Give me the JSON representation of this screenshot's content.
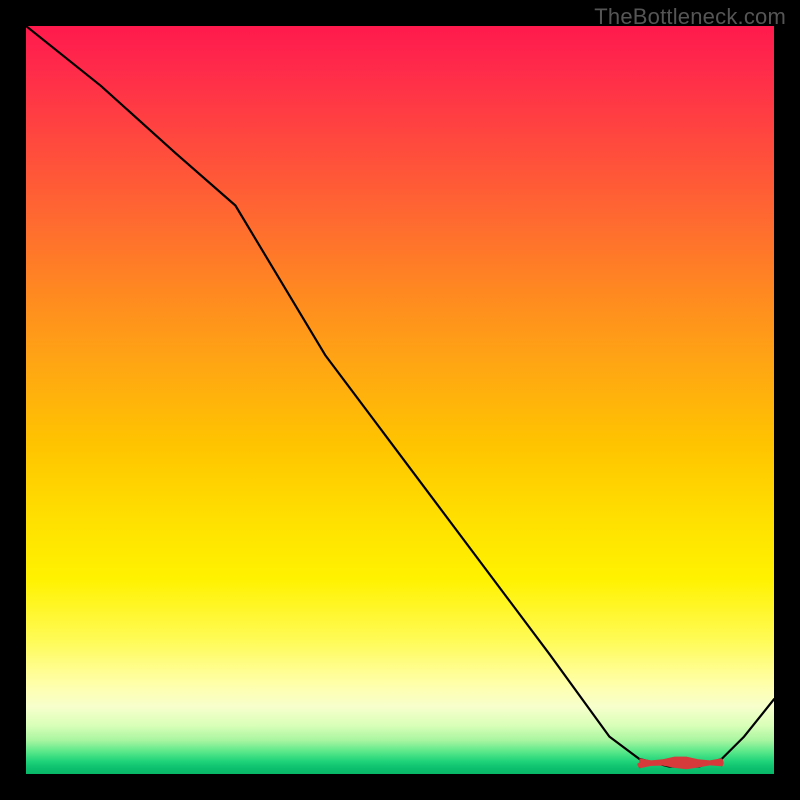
{
  "watermark": "TheBottleneck.com",
  "chart_data": {
    "type": "line",
    "title": "",
    "xlabel": "",
    "ylabel": "",
    "xlim": [
      0,
      100
    ],
    "ylim": [
      0,
      100
    ],
    "grid": false,
    "legend": false,
    "background": {
      "gradient": "vertical",
      "stops": [
        {
          "pos": 0.0,
          "color": "#ff1a4d"
        },
        {
          "pos": 0.25,
          "color": "#ff6a30"
        },
        {
          "pos": 0.55,
          "color": "#ffc400"
        },
        {
          "pos": 0.75,
          "color": "#fff200"
        },
        {
          "pos": 0.92,
          "color": "#d9ffb8"
        },
        {
          "pos": 1.0,
          "color": "#08b867"
        }
      ]
    },
    "series": [
      {
        "name": "curve",
        "x": [
          0,
          10,
          20,
          28,
          40,
          55,
          70,
          78,
          82,
          86,
          90,
          93,
          96,
          100
        ],
        "values": [
          100,
          92,
          83,
          76,
          56,
          36,
          16,
          5,
          2,
          1,
          1,
          2,
          5,
          10
        ]
      }
    ],
    "annotations": [
      {
        "name": "bottom-blob",
        "type": "marker",
        "x_range": [
          82,
          93
        ],
        "y": 1.5,
        "color": "#d63a3a"
      }
    ]
  }
}
